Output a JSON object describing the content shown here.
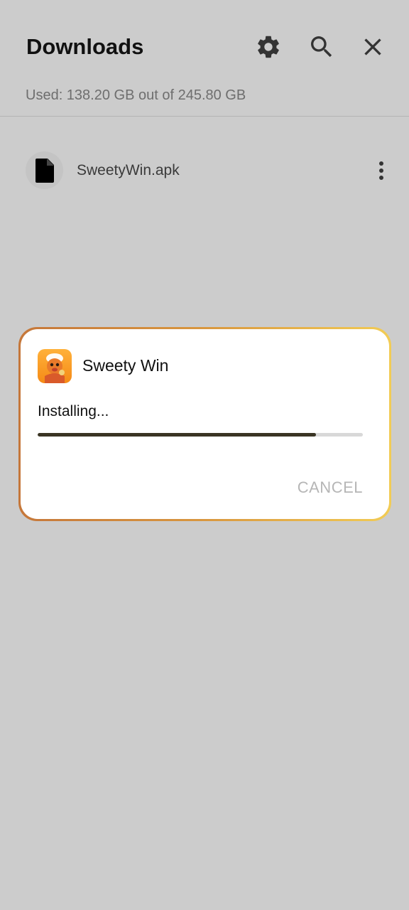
{
  "header": {
    "title": "Downloads",
    "storage_text": "Used: 138.20 GB out of 245.80 GB",
    "icons": [
      "gear-icon",
      "search-icon",
      "close-icon"
    ]
  },
  "files": [
    {
      "name": "SweetyWin.apk",
      "icon": "file-icon"
    }
  ],
  "dialog": {
    "app_name": "Sweety Win",
    "status": "Installing...",
    "progress": 0.855,
    "cancel_label": "CANCEL"
  },
  "colors": {
    "background": "#cccccc",
    "progress_fill": "#3a3524",
    "dialog_border_start": "#c5773a",
    "dialog_border_end": "#f2cc55"
  }
}
